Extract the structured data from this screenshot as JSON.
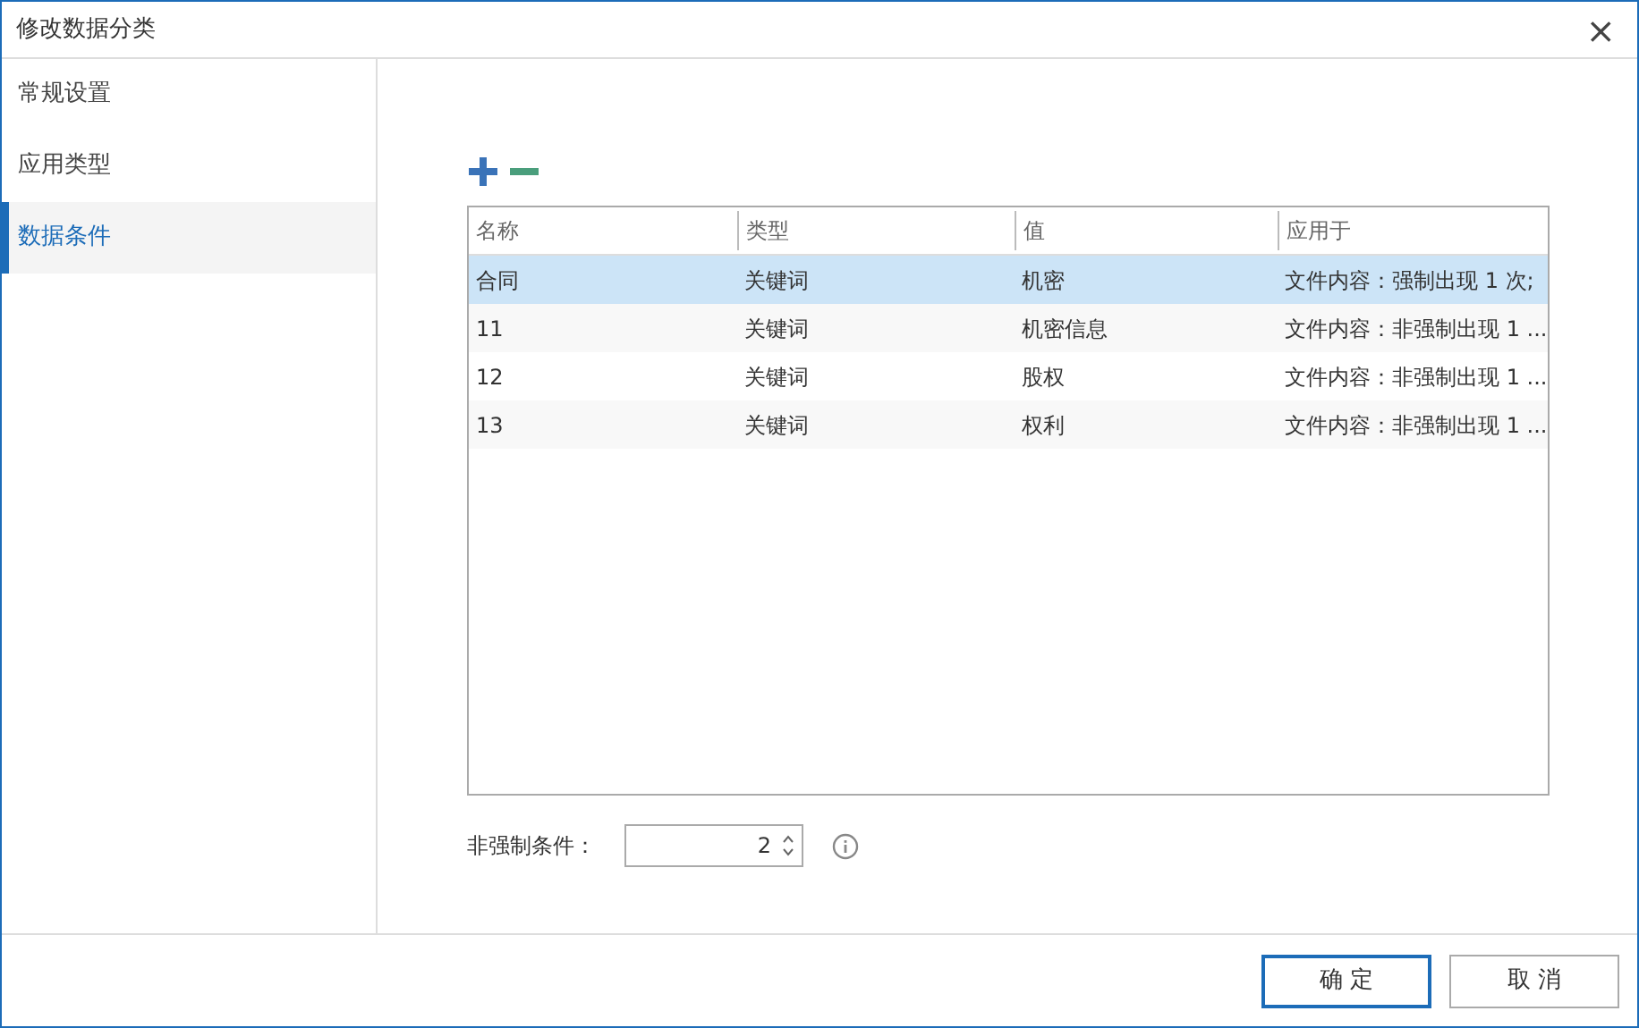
{
  "window": {
    "title": "修改数据分类",
    "close": "×"
  },
  "sidebar": {
    "items": [
      {
        "label": "常规设置",
        "selected": false
      },
      {
        "label": "应用类型",
        "selected": false
      },
      {
        "label": "数据条件",
        "selected": true
      }
    ]
  },
  "table": {
    "columns": [
      "名称",
      "类型",
      "值",
      "应用于"
    ],
    "rows": [
      {
        "selected": true,
        "cells": [
          "合同",
          "关键词",
          "机密",
          "文件内容：强制出现 1 次;"
        ]
      },
      {
        "selected": false,
        "cells": [
          "11",
          "关键词",
          "机密信息",
          "文件内容：非强制出现 1 ..."
        ]
      },
      {
        "selected": false,
        "cells": [
          "12",
          "关键词",
          "股权",
          "文件内容：非强制出现 1 ..."
        ]
      },
      {
        "selected": false,
        "cells": [
          "13",
          "关键词",
          "权利",
          "文件内容：非强制出现 1 ..."
        ]
      }
    ]
  },
  "optional_conditions": {
    "label": "非强制条件：",
    "value": "2"
  },
  "buttons": [
    {
      "label": "确 定",
      "primary": true
    },
    {
      "label": "取 消",
      "primary": false
    }
  ]
}
